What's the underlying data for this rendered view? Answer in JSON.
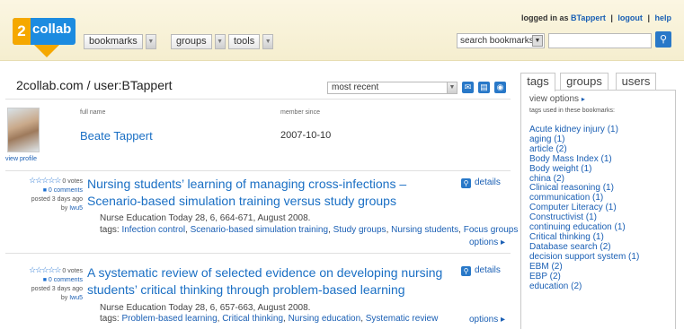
{
  "header": {
    "logo_number": "2",
    "logo_word": "collab",
    "menus": [
      "bookmarks",
      "groups",
      "tools"
    ],
    "login_text": "logged in as",
    "username": "BTappert",
    "logout": "logout",
    "help": "help",
    "search_scope": "search bookmarks",
    "search_value": ""
  },
  "main": {
    "breadcrumb": "2collab.com / user:BTappert",
    "sort": "most recent"
  },
  "profile": {
    "view_profile": "view profile",
    "full_name_label": "full name",
    "member_since_label": "member since",
    "name": "Beate Tappert",
    "since": "2007-10-10"
  },
  "entries": [
    {
      "stars": "☆☆☆☆☆",
      "votes": "0 votes",
      "comments": "0 comments",
      "posted": "posted 3 days ago",
      "by": "by",
      "author": "Iwu5",
      "title": "Nursing students’ learning of managing cross-infections – Scenario-based simulation training versus study groups",
      "citation": "Nurse Education Today 28, 6, 664-671, August 2008.",
      "tags_label": "tags:",
      "tags": [
        "Infection control",
        "Scenario-based simulation training",
        "Study groups",
        "Nursing students",
        "Focus groups"
      ],
      "details": "details",
      "options": "options ▸"
    },
    {
      "stars": "☆☆☆☆☆",
      "votes": "0 votes",
      "comments": "0 comments",
      "posted": "posted 3 days ago",
      "by": "by",
      "author": "Iwu5",
      "title": "A systematic review of selected evidence on developing nursing students’ critical thinking through problem-based learning",
      "citation": "Nurse Education Today 28, 6, 657-663, August 2008.",
      "tags_label": "tags:",
      "tags": [
        "Problem-based learning",
        "Critical thinking",
        "Nursing education",
        "Systematic review"
      ],
      "details": "details",
      "options": "options ▸"
    }
  ],
  "sidebar": {
    "tabs": [
      "tags",
      "groups",
      "users"
    ],
    "view_options": "view options",
    "used_label": "tags used in these bookmarks:",
    "tags": [
      "Acute kidney injury (1)",
      "aging (1)",
      "article (2)",
      "Body Mass Index (1)",
      "Body weight (1)",
      "china (2)",
      "Clinical reasoning (1)",
      "communication (1)",
      "Computer Literacy (1)",
      "Constructivist (1)",
      "continuing education (1)",
      "Critical thinking (1)",
      "Database search (2)",
      "decision support system (1)",
      "EBM (2)",
      "EBP (2)",
      "education (2)"
    ]
  },
  "colors": {
    "accent": "#2878c8",
    "link": "#1a5fb4",
    "header_bg": "#f8f2d8",
    "logo_orange": "#f5a800"
  }
}
